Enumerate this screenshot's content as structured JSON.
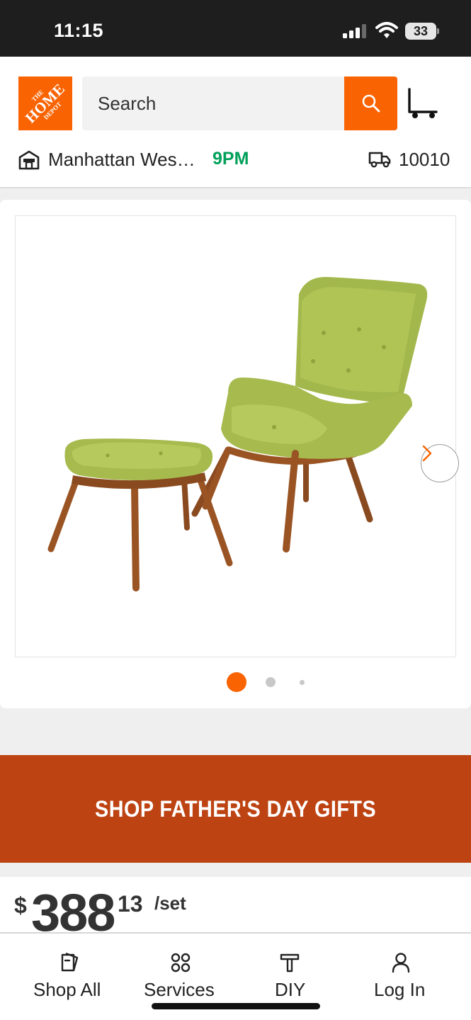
{
  "status_bar": {
    "time": "11:15",
    "battery": "33"
  },
  "header": {
    "logo_text_line1": "THE",
    "logo_text_line2": "HOME",
    "logo_text_line3": "DEPOT",
    "search_placeholder": "Search",
    "store_name": "Manhattan Wes…",
    "store_hours": "9PM",
    "zip_code": "10010",
    "brand_color": "#f96302",
    "hours_color": "#00a05a"
  },
  "gallery": {
    "image_subject": "green tufted wingback lounge chair with ottoman on walnut legs",
    "total_images": 3,
    "active_index": 0
  },
  "banner": {
    "text": "SHOP FATHER'S DAY GIFTS",
    "color": "#bd4312"
  },
  "price": {
    "currency": "$",
    "dollars": "388",
    "cents": "13",
    "unit": "/set"
  },
  "bottom_nav": {
    "items": [
      {
        "label": "Shop All",
        "icon": "shop-all-icon"
      },
      {
        "label": "Services",
        "icon": "services-icon"
      },
      {
        "label": "DIY",
        "icon": "diy-hammer-icon"
      },
      {
        "label": "Log In",
        "icon": "user-icon"
      }
    ]
  }
}
